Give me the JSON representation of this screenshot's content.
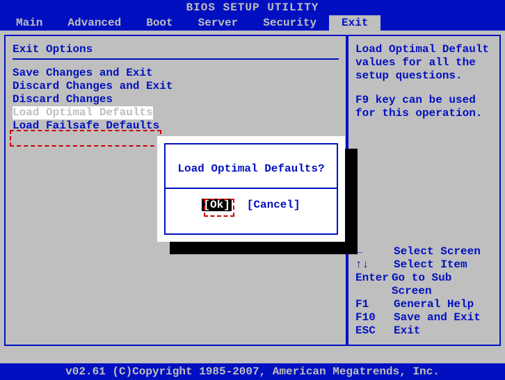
{
  "title": "BIOS SETUP UTILITY",
  "menubar": {
    "items": [
      "Main",
      "Advanced",
      "Boot",
      "Server",
      "Security",
      "Exit"
    ],
    "selected": "Exit"
  },
  "left_panel": {
    "heading": "Exit Options",
    "options": [
      "Save Changes and Exit",
      "Discard Changes and Exit",
      "Discard Changes",
      "",
      "Load Optimal Defaults",
      "Load Failsafe Defaults"
    ],
    "highlighted_index": 4
  },
  "right_panel": {
    "description": "Load Optimal Default values for all the setup questions.",
    "description2": "F9 key can be used for this operation.",
    "keyhints": [
      {
        "key": "←",
        "label": "Select Screen"
      },
      {
        "key": "↑↓",
        "label": "Select Item"
      },
      {
        "key": "Enter",
        "label": "Go to Sub Screen"
      },
      {
        "key": "F1",
        "label": "General Help"
      },
      {
        "key": "F10",
        "label": "Save and Exit"
      },
      {
        "key": "ESC",
        "label": "Exit"
      }
    ]
  },
  "dialog": {
    "message": "Load Optimal Defaults?",
    "ok": "[Ok]",
    "cancel": "[Cancel]"
  },
  "footer": "v02.61 (C)Copyright 1985-2007, American Megatrends, Inc."
}
